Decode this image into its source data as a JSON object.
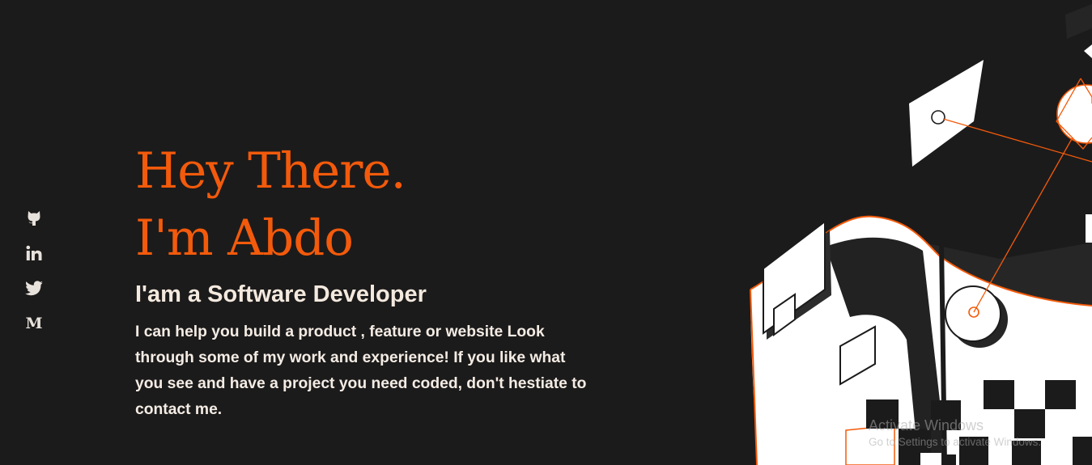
{
  "social": {
    "items": [
      {
        "name": "github",
        "icon": "github-icon"
      },
      {
        "name": "linkedin",
        "icon": "linkedin-icon"
      },
      {
        "name": "twitter",
        "icon": "twitter-icon"
      },
      {
        "name": "medium",
        "icon": "medium-icon",
        "glyph": "M"
      }
    ]
  },
  "hero": {
    "greeting_line1": "Hey There.",
    "greeting_line2": "I'm Abdo",
    "role": "I'am a Software Developer",
    "intro": "I can help you build a product , feature or website Look through some of my work and experience! If you like what you see and have a project you need coded, don't hestiate to contact me."
  },
  "watermark": {
    "title": "Activate Windows",
    "subtitle": "Go to Settings to activate Windows."
  },
  "colors": {
    "background": "#1c1b1b",
    "accent": "#f35a0b",
    "heading_text": "#f4e9de",
    "body_text": "#f4ece4"
  }
}
